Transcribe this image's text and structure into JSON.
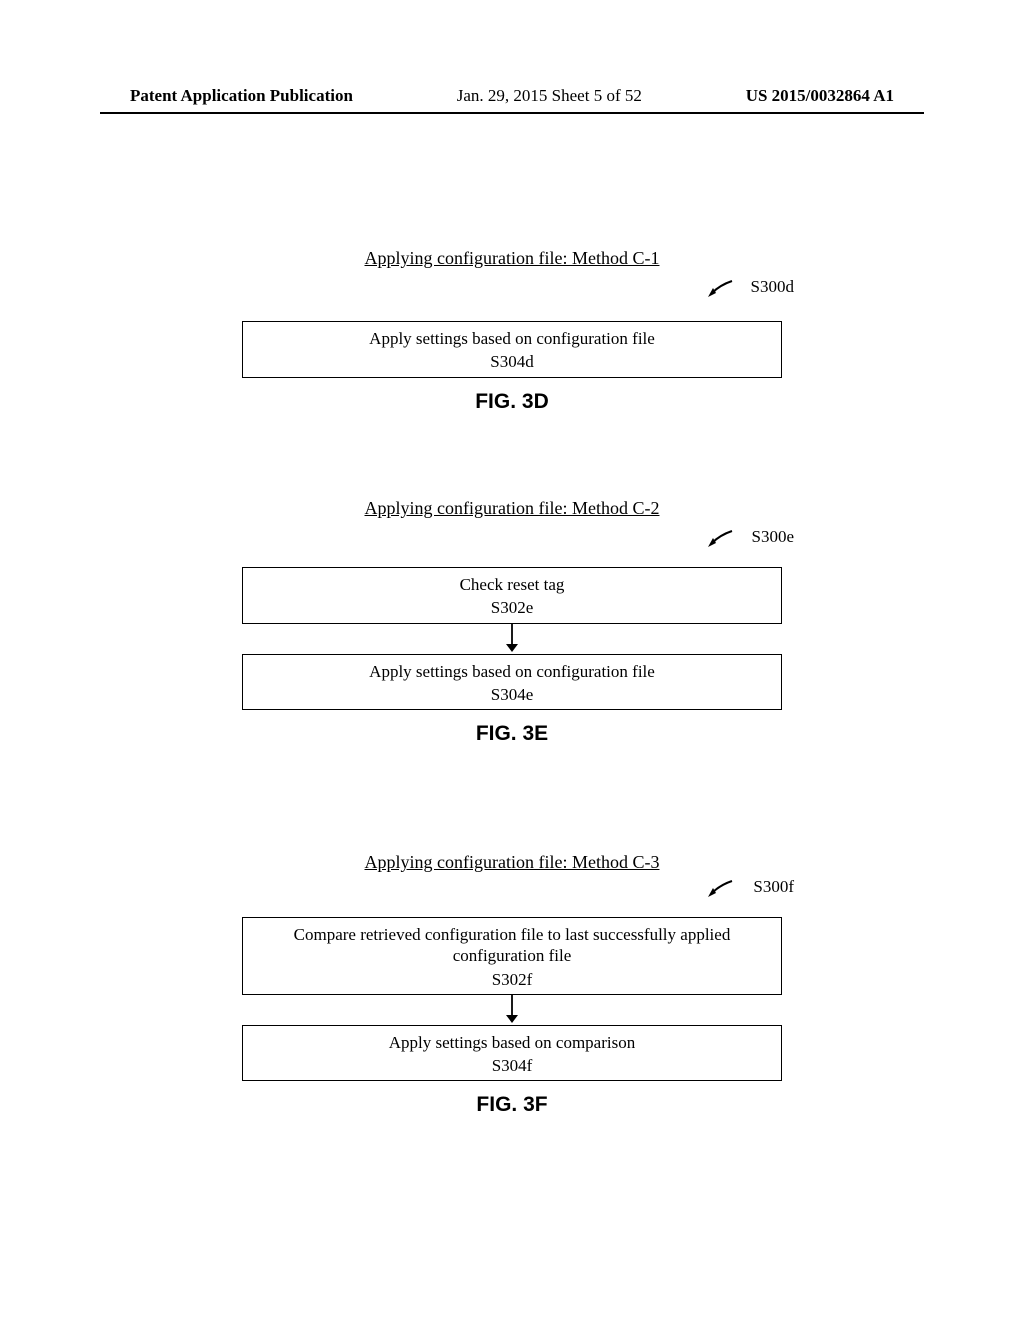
{
  "header": {
    "publication": "Patent Application Publication",
    "date_sheet": "Jan. 29, 2015  Sheet 5 of 52",
    "pubnum": "US 2015/0032864 A1"
  },
  "fig_d": {
    "title": "Applying configuration file: Method C-1",
    "ref": "S300d",
    "step1_text": "Apply settings based on configuration file",
    "step1_code": "S304d",
    "label": "FIG. 3D"
  },
  "fig_e": {
    "title": "Applying configuration file: Method C-2",
    "ref": "S300e",
    "step1_text": "Check reset tag",
    "step1_code": "S302e",
    "step2_text": "Apply settings based on configuration file",
    "step2_code": "S304e",
    "label": "FIG. 3E"
  },
  "fig_f": {
    "title": "Applying configuration file: Method C-3",
    "ref": "S300f",
    "step1_text": "Compare retrieved configuration file to last successfully applied configuration file",
    "step1_code": "S302f",
    "step2_text": "Apply settings based on comparison",
    "step2_code": "S304f",
    "label": "FIG. 3F"
  }
}
